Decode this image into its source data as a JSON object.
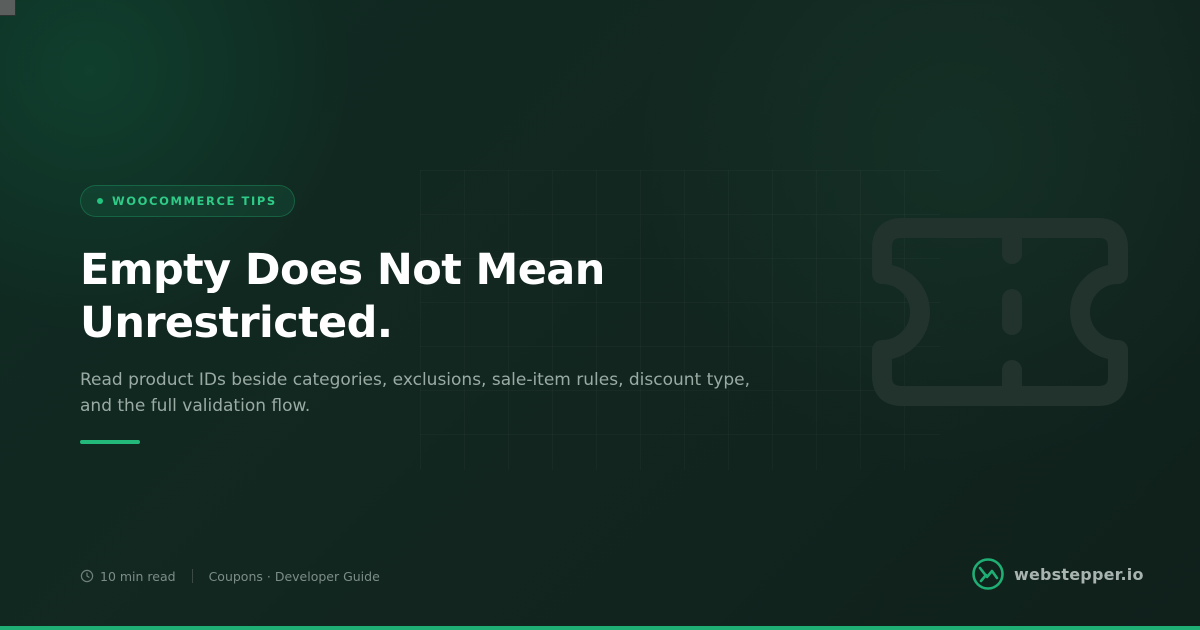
{
  "badge": {
    "label": "WOOCOMMERCE TIPS"
  },
  "headline": {
    "line1": "Empty Does Not Mean",
    "line2": "Unrestricted."
  },
  "subtitle": {
    "line1": "Read product IDs beside categories, exclusions, sale-item rules, discount type,",
    "line2": "and the full validation flow."
  },
  "meta": {
    "read_time": "10 min read",
    "category": "Coupons · Developer Guide"
  },
  "brand": {
    "name": "webstepper.io"
  },
  "icons": {
    "clock": "clock-icon",
    "ticket": "ticket-icon",
    "logo": "webstepper-logo-icon"
  },
  "colors": {
    "accent": "#22b97a",
    "badge_text": "#2fcb87",
    "background": "#122720"
  }
}
